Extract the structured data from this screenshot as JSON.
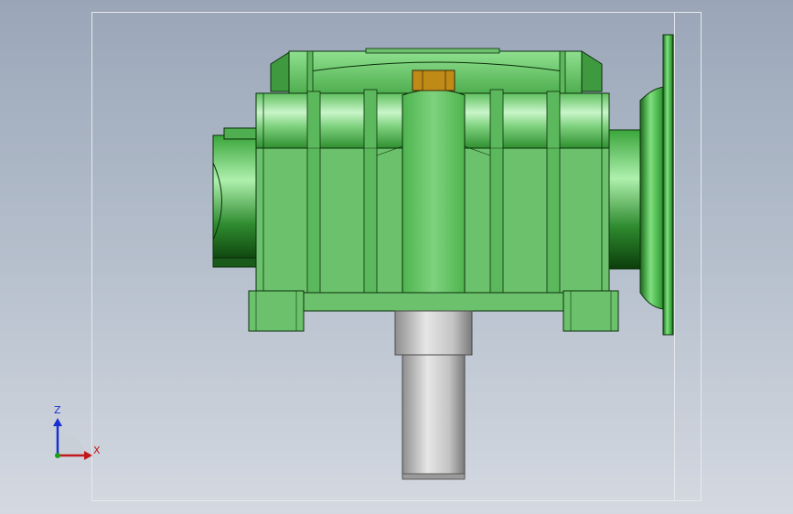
{
  "viewport": {
    "background_top": "#9aa6b8",
    "background_bottom": "#d4d9e1"
  },
  "model": {
    "name": "worm-gear-reducer",
    "body_color": "#6cc26c",
    "body_shade_color": "#3f9a3f",
    "edge_color": "#0b2f0b",
    "shaft_color": "#c8c8c8",
    "key_color": "#c08a17"
  },
  "triad": {
    "z_label": "Z",
    "x_label": "X",
    "z_color": "#1a2fd0",
    "x_color": "#c2181b",
    "y_color": "#1aa01a"
  }
}
